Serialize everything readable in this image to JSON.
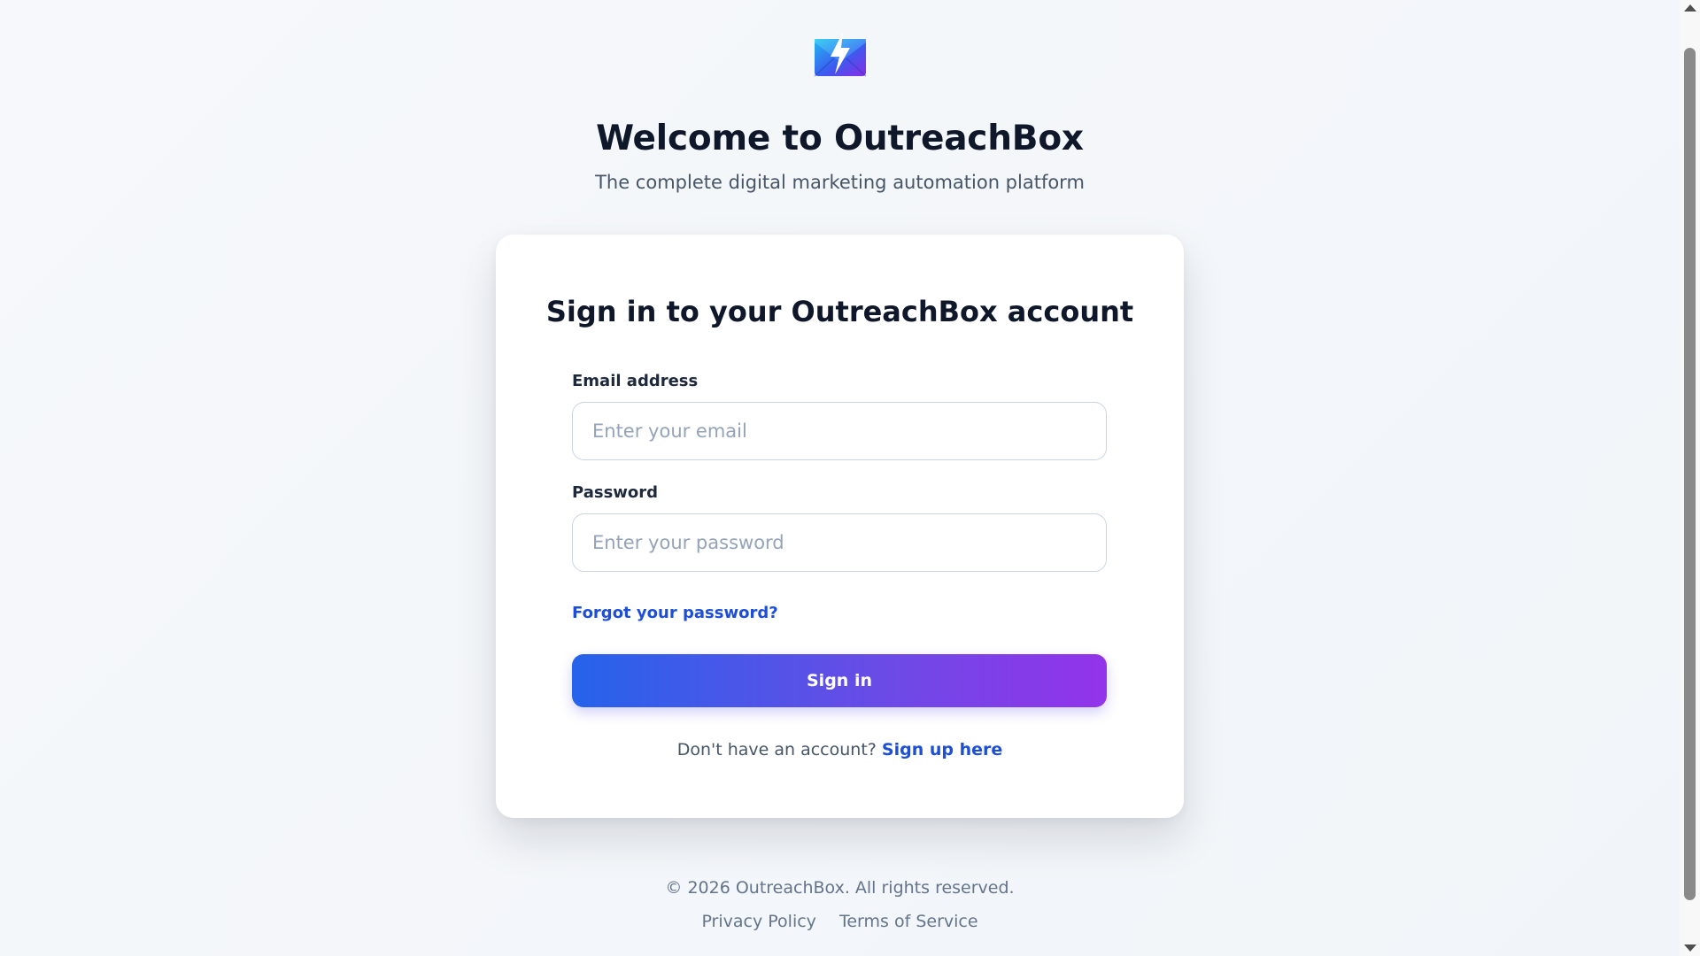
{
  "brand": {
    "logo_icon": "envelope-lightning-icon",
    "title": "Welcome to OutreachBox",
    "subtitle": "The complete digital marketing automation platform"
  },
  "card": {
    "title": "Sign in to your OutreachBox account",
    "email_label": "Email address",
    "email_placeholder": "Enter your email",
    "email_value": "",
    "password_label": "Password",
    "password_placeholder": "Enter your password",
    "password_value": "",
    "forgot_link": "Forgot your password?",
    "signin_button": "Sign in",
    "signup_prompt": "Don't have an account?",
    "signup_link": "Sign up here"
  },
  "footer": {
    "copyright": "© 2026 OutreachBox. All rights reserved.",
    "links": [
      "Privacy Policy",
      "Terms of Service"
    ]
  },
  "colors": {
    "primary_gradient_start": "#2563eb",
    "primary_gradient_end": "#9333ea",
    "link": "#1d4ed8",
    "heading": "#0f172a",
    "background": "#f4f7fb"
  }
}
